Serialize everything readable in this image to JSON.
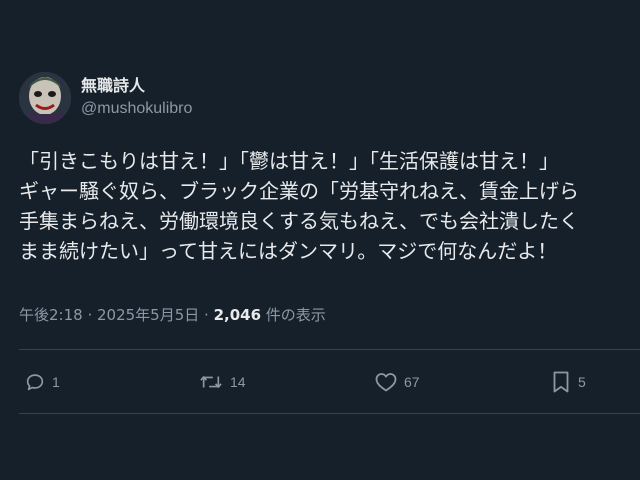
{
  "author": {
    "display_name": "無職詩人",
    "handle": "@mushokulibro"
  },
  "tweet": {
    "lines": [
      "「引きこもりは甘え！」「鬱は甘え！」「生活保護は甘え！」",
      "ギャー騒ぐ奴ら、ブラック企業の「労基守れねえ、賃金上げら",
      "手集まらねえ、労働環境良くする気もねえ、でも会社潰したく",
      "まま続けたい」って甘えにはダンマリ。マジで何なんだよ！"
    ]
  },
  "meta": {
    "timestamp": "午後2:18 · 2025年5月5日 · ",
    "views_count": "2,046",
    "views_label": " 件の表示"
  },
  "actions": {
    "reply_count": "1",
    "retweet_count": "14",
    "like_count": "67",
    "bookmark_count": "5"
  },
  "icons": {
    "reply": "reply-icon",
    "retweet": "retweet-icon",
    "like": "heart-icon",
    "bookmark": "bookmark-icon"
  },
  "colors": {
    "background": "#15202b",
    "text_primary": "#e7e9ea",
    "text_secondary": "#8b98a5",
    "divider": "#38444d"
  }
}
